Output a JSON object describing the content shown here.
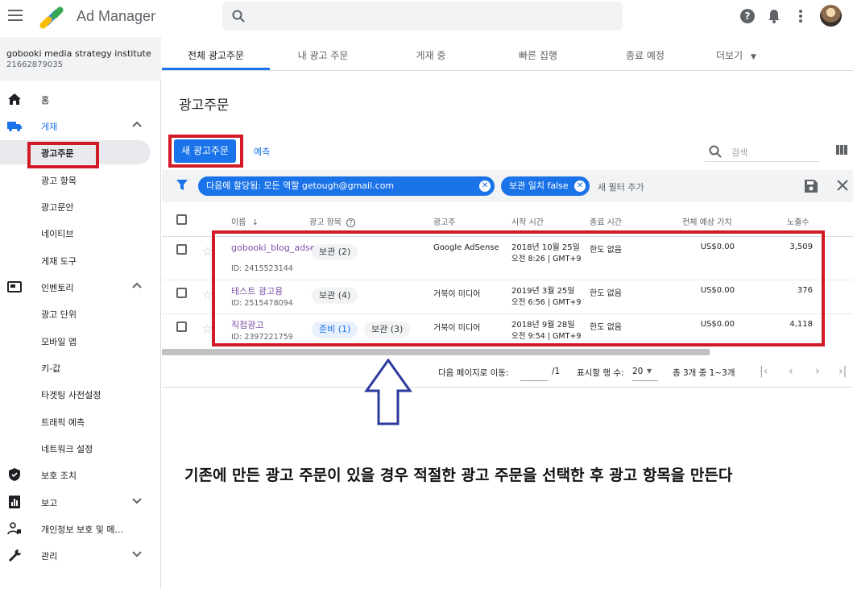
{
  "app": {
    "title": "Ad Manager",
    "search_placeholder": ""
  },
  "network": {
    "name": "gobooki media strategy institute",
    "code": "21662879035"
  },
  "sidebar": {
    "items": [
      {
        "label": "홈",
        "icon": "home-icon"
      },
      {
        "label": "게재",
        "icon": "truck-icon",
        "chevron": "chevron-up-icon"
      },
      {
        "label": "광고주문",
        "active": true
      },
      {
        "label": "광고 항목"
      },
      {
        "label": "광고문안"
      },
      {
        "label": "네이티브"
      },
      {
        "label": "게재 도구"
      },
      {
        "label": "인벤토리",
        "icon": "inventory-icon",
        "chevron": "chevron-up-icon"
      },
      {
        "label": "광고 단위"
      },
      {
        "label": "모바일 앱"
      },
      {
        "label": "키-값"
      },
      {
        "label": "타겟팅 사전설정"
      },
      {
        "label": "트래픽 예측"
      },
      {
        "label": "네트워크 설정"
      },
      {
        "label": "보호 조치",
        "icon": "shield-icon"
      },
      {
        "label": "보고",
        "icon": "report-icon",
        "chevron": "chevron-down-icon"
      },
      {
        "label": "개인정보 보호 및 메...",
        "icon": "privacy-icon"
      },
      {
        "label": "관리",
        "icon": "wrench-icon",
        "chevron": "chevron-down-icon"
      }
    ]
  },
  "tabs": [
    "전체 광고주문",
    "내 광고 주문",
    "게재 중",
    "빠른 집행",
    "종료 예정",
    "더보기"
  ],
  "page": {
    "title": "광고주문"
  },
  "toolbar": {
    "new_order": "새 광고주문",
    "forecast": "예측",
    "search_label": "검색"
  },
  "filters": {
    "chips": [
      "다음에 할당됨: 모든 역할 getough@gmail.com (getough@gmail.com)",
      "보관 일치 false"
    ],
    "add_filter": "새 필터 추가"
  },
  "table": {
    "columns": [
      "이름",
      "광고 항목",
      "광고주",
      "시작 시간",
      "종료 시간",
      "전체 예상 가치",
      "노출수"
    ],
    "rows": [
      {
        "name": "gobooki_blog_adsense",
        "id": "ID: 2415523144",
        "line_items": [
          "보관 (2)"
        ],
        "advertiser": "Google AdSense",
        "start_date": "2018년 10월 25일",
        "start_time": "오전 8:26 | GMT+9",
        "end": "한도 없음",
        "value": "US$0.00",
        "impressions": "3,509"
      },
      {
        "name": "테스트 광고용",
        "id": "ID: 2515478094",
        "line_items": [
          "보관 (4)"
        ],
        "advertiser": "거북이 미디어",
        "start_date": "2019년 3월 25일",
        "start_time": "오전 6:56 | GMT+9",
        "end": "한도 없음",
        "value": "US$0.00",
        "impressions": "376"
      },
      {
        "name": "직접광고",
        "id": "ID: 2397221759",
        "line_items": [
          "준비 (1)",
          "보관 (3)"
        ],
        "advertiser": "거북이 미디어",
        "start_date": "2018년 9월 28일",
        "start_time": "오전 9:54 | GMT+9",
        "end": "한도 없음",
        "value": "US$0.00",
        "impressions": "4,118"
      }
    ]
  },
  "pagination": {
    "goto_label": "다음 페이지로 이동:",
    "total_pages": "/1",
    "rows_label": "표시할 행 수:",
    "rows_value": "20",
    "summary": "총 3개 중 1~3개"
  },
  "annotation": {
    "caption": "기존에 만든 광고 주문이 있을 경우 적절한 광고 주문을 선택한 후 광고 항목을 만든다",
    "highlight_color": "#d21a26",
    "arrow_color": "#2e3a9e"
  },
  "colors": {
    "accent": "#1a73e8",
    "link_purple": "#7b4fa3"
  }
}
